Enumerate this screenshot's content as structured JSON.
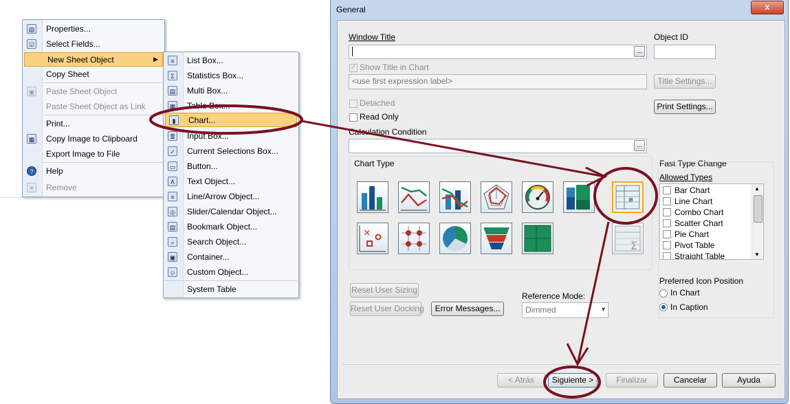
{
  "context_menu": {
    "items": [
      {
        "label": "Properties...",
        "icon": "properties-icon",
        "glyph": "▤",
        "disabled": false
      },
      {
        "label": "Select Fields...",
        "icon": "select-fields-icon",
        "glyph": "☑",
        "disabled": false
      },
      {
        "label": "New Sheet Object",
        "icon": "",
        "glyph": "",
        "disabled": false,
        "highlighted": true,
        "submenu": true
      },
      {
        "label": "Copy Sheet",
        "icon": "",
        "glyph": "",
        "disabled": false
      },
      {
        "label": "Paste Sheet Object",
        "icon": "paste-icon",
        "glyph": "▣",
        "disabled": true
      },
      {
        "label": "Paste Sheet Object as Link",
        "icon": "",
        "glyph": "",
        "disabled": true
      },
      {
        "label": "Print...",
        "icon": "",
        "glyph": "",
        "disabled": false
      },
      {
        "label": "Copy Image to Clipboard",
        "icon": "clipboard-icon",
        "glyph": "▦",
        "disabled": false
      },
      {
        "label": "Export Image to File",
        "icon": "",
        "glyph": "",
        "disabled": false
      },
      {
        "label": "Help",
        "icon": "help-icon",
        "glyph": "?",
        "disabled": false
      },
      {
        "label": "Remove",
        "icon": "remove-icon",
        "glyph": "✕",
        "disabled": true
      }
    ]
  },
  "submenu": {
    "items": [
      {
        "label": "List Box...",
        "icon": "list-box-icon",
        "glyph": "≡"
      },
      {
        "label": "Statistics Box...",
        "icon": "statistics-box-icon",
        "glyph": "Σ"
      },
      {
        "label": "Multi Box...",
        "icon": "multi-box-icon",
        "glyph": "▤"
      },
      {
        "label": "Table Box...",
        "icon": "table-box-icon",
        "glyph": "▦"
      },
      {
        "label": "Chart...",
        "icon": "chart-icon",
        "glyph": "▮",
        "highlighted": true
      },
      {
        "label": "Input Box...",
        "icon": "input-box-icon",
        "glyph": "≣"
      },
      {
        "label": "Current Selections Box...",
        "icon": "current-selections-icon",
        "glyph": "✓"
      },
      {
        "label": "Button...",
        "icon": "button-icon",
        "glyph": "▭"
      },
      {
        "label": "Text Object...",
        "icon": "text-object-icon",
        "glyph": "A"
      },
      {
        "label": "Line/Arrow Object...",
        "icon": "line-arrow-icon",
        "glyph": "≡"
      },
      {
        "label": "Slider/Calendar Object...",
        "icon": "slider-calendar-icon",
        "glyph": "◎"
      },
      {
        "label": "Bookmark Object...",
        "icon": "bookmark-icon",
        "glyph": "▤"
      },
      {
        "label": "Search Object...",
        "icon": "search-icon",
        "glyph": "⌕"
      },
      {
        "label": "Container...",
        "icon": "container-icon",
        "glyph": "▣"
      },
      {
        "label": "Custom Object...",
        "icon": "custom-object-icon",
        "glyph": "☺"
      },
      {
        "label": "System Table",
        "icon": "",
        "glyph": ""
      }
    ]
  },
  "dialog": {
    "title": "General",
    "close_label": "x",
    "window_title_label": "Window Title",
    "window_title_value": "",
    "object_id_label": "Object ID",
    "object_id_value": "",
    "show_title_label": "Show Title in Chart",
    "show_title_checked": true,
    "title_placeholder": "<use first expression label>",
    "title_settings_label": "Title Settings...",
    "print_settings_label": "Print Settings...",
    "detached_label": "Detached",
    "read_only_label": "Read Only",
    "calc_condition_label": "Calculation Condition",
    "calc_condition_value": "",
    "dots_label": "...",
    "chart_type_label": "Chart Type",
    "fast_type_change_label": "Fast Type Change",
    "allowed_types_label": "Allowed Types",
    "allowed_types": [
      "Bar Chart",
      "Line Chart",
      "Combo Chart",
      "Scatter Chart",
      "Pie Chart",
      "Pivot Table",
      "Straight Table"
    ],
    "preferred_icon_label": "Preferred Icon Position",
    "in_chart_label": "In Chart",
    "in_caption_label": "In Caption",
    "preferred_selected": "In Caption",
    "reset_user_sizing_label": "Reset User Sizing",
    "reset_user_docking_label": "Reset User Docking",
    "error_messages_label": "Error Messages...",
    "reference_mode_label": "Reference Mode:",
    "reference_mode_value": "Dimmed",
    "back_label": "< Atrás",
    "next_label": "Siguiente >",
    "finish_label": "Finalizar",
    "cancel_label": "Cancelar",
    "help_label": "Ayuda",
    "selected_chart_type": "pivot-table"
  },
  "colors": {
    "annotation": "#7a1020",
    "menu_highlight": "#f8d27e",
    "selected_tile": "#f5a623"
  }
}
